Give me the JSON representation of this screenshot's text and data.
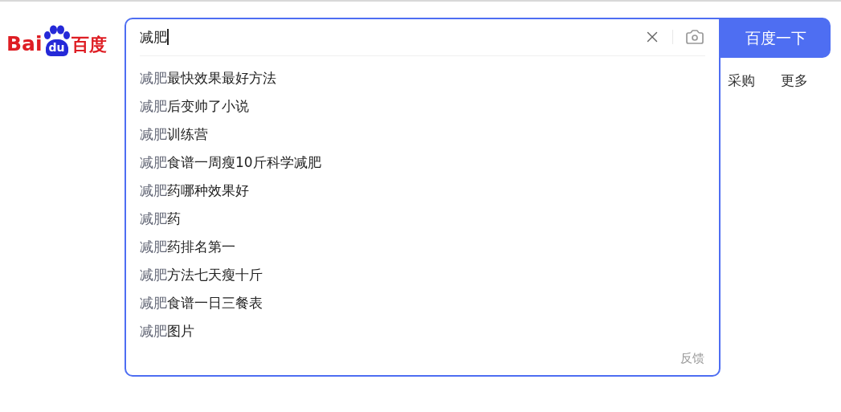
{
  "logo": {
    "left": "Bai",
    "paw": "du",
    "right": "百度"
  },
  "search": {
    "value": "减肥",
    "cursor": true
  },
  "button": "百度一下",
  "nav_links": [
    "采购",
    "更多"
  ],
  "suggestions": [
    {
      "typed": "减肥",
      "rest": "最快效果最好方法"
    },
    {
      "typed": "减肥",
      "rest": "后变帅了小说"
    },
    {
      "typed": "减肥",
      "rest": "训练营"
    },
    {
      "typed": "减肥",
      "rest": "食谱一周瘦10斤科学减肥"
    },
    {
      "typed": "减肥",
      "rest": "药哪种效果好"
    },
    {
      "typed": "减肥",
      "rest": "药"
    },
    {
      "typed": "减肥",
      "rest": "药排名第一"
    },
    {
      "typed": "减肥",
      "rest": "方法七天瘦十斤"
    },
    {
      "typed": "减肥",
      "rest": "食谱一日三餐表"
    },
    {
      "typed": "减肥",
      "rest": "图片"
    }
  ],
  "feedback": "反馈"
}
